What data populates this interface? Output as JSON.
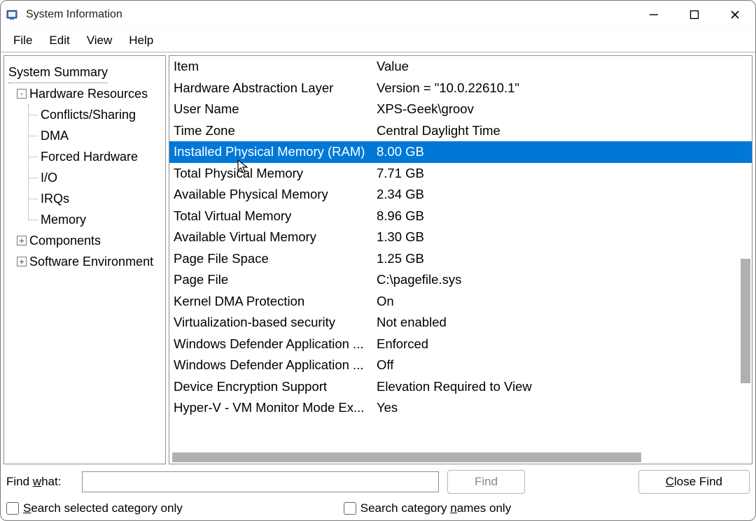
{
  "window": {
    "title": "System Information"
  },
  "menu": {
    "file": "File",
    "edit": "Edit",
    "view": "View",
    "help": "Help"
  },
  "tree": {
    "root": "System Summary",
    "hardware": "Hardware Resources",
    "hw_children": [
      "Conflicts/Sharing",
      "DMA",
      "Forced Hardware",
      "I/O",
      "IRQs",
      "Memory"
    ],
    "components": "Components",
    "software_env": "Software Environment"
  },
  "list": {
    "header_item": "Item",
    "header_value": "Value",
    "rows": [
      {
        "item": "Hardware Abstraction Layer",
        "value": "Version = \"10.0.22610.1\""
      },
      {
        "item": "User Name",
        "value": "XPS-Geek\\groov"
      },
      {
        "item": "Time Zone",
        "value": "Central Daylight Time"
      },
      {
        "item": "Installed Physical Memory (RAM)",
        "value": "8.00 GB",
        "selected": true
      },
      {
        "item": "Total Physical Memory",
        "value": "7.71 GB"
      },
      {
        "item": "Available Physical Memory",
        "value": "2.34 GB"
      },
      {
        "item": "Total Virtual Memory",
        "value": "8.96 GB"
      },
      {
        "item": "Available Virtual Memory",
        "value": "1.30 GB"
      },
      {
        "item": "Page File Space",
        "value": "1.25 GB"
      },
      {
        "item": "Page File",
        "value": "C:\\pagefile.sys"
      },
      {
        "item": "Kernel DMA Protection",
        "value": "On"
      },
      {
        "item": "Virtualization-based security",
        "value": "Not enabled"
      },
      {
        "item": "Windows Defender Application ...",
        "value": "Enforced"
      },
      {
        "item": "Windows Defender Application ...",
        "value": "Off"
      },
      {
        "item": "Device Encryption Support",
        "value": "Elevation Required to View"
      },
      {
        "item": "Hyper-V - VM Monitor Mode Ex...",
        "value": "Yes"
      }
    ]
  },
  "find": {
    "label_pre": "Find ",
    "label_u": "w",
    "label_post": "hat:",
    "button": "Find",
    "close_u": "C",
    "close_post": "lose Find"
  },
  "options": {
    "opt1_u": "S",
    "opt1_post": "earch selected category only",
    "opt2_pre": "Search category ",
    "opt2_u": "n",
    "opt2_post": "ames only"
  },
  "colors": {
    "selection": "#0078D7"
  }
}
